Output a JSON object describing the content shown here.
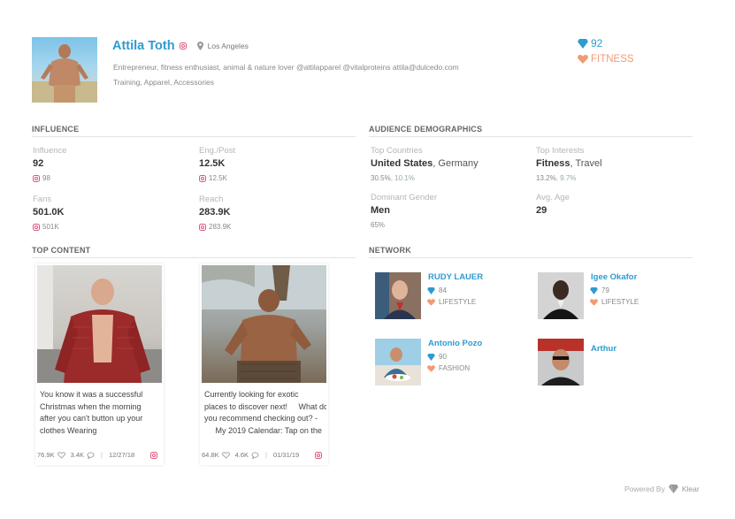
{
  "profile": {
    "name": "Attila Toth",
    "location": "Los Angeles",
    "bio_line1": "Entrepreneur, fitness enthusiast, animal & nature lover @attilapparel @vitalproteins attila@dulcedo.com",
    "bio_line2": "Training, Apparel, Accessories",
    "score": "92",
    "category": "FITNESS"
  },
  "influence": {
    "title": "INFLUENCE",
    "influence_label": "Influence",
    "influence_value": "92",
    "influence_sub": "98",
    "eng_label": "Eng./Post",
    "eng_value": "12.5K",
    "eng_sub": "12.5K",
    "fans_label": "Fans",
    "fans_value": "501.0K",
    "fans_sub": "501K",
    "reach_label": "Reach",
    "reach_value": "283.9K",
    "reach_sub": "283.9K"
  },
  "audience": {
    "title": "AUDIENCE DEMOGRAPHICS",
    "countries_label": "Top Countries",
    "country1": "United States",
    "country_sep": ", ",
    "country2": "Germany",
    "country_pct1": "30.5%",
    "country_pct_sep": ", ",
    "country_pct2": "10.1%",
    "interests_label": "Top Interests",
    "interest1": "Fitness",
    "interest_sep": ", ",
    "interest2": "Travel",
    "interest_pct1": "13.2%",
    "interest_pct_sep": ", ",
    "interest_pct2": "9.7%",
    "gender_label": "Dominant Gender",
    "gender_value": "Men",
    "gender_pct": "65%",
    "age_label": "Avg. Age",
    "age_value": "29"
  },
  "top_content": {
    "title": "TOP CONTENT",
    "posts": [
      {
        "caption": "You know it was a successful\nChristmas when the morning\nafter you can't button up your\nclothes    Wearing",
        "likes": "76.9K",
        "comments": "3.4K",
        "sep": "|",
        "date": "12/27/18"
      },
      {
        "caption": "Currently looking for exotic\nplaces to discover next!     What do\nyou recommend checking out? -\n     My 2019 Calendar: Tap on the",
        "likes": "64.8K",
        "comments": "4.6K",
        "sep": "|",
        "date": "01/31/19"
      }
    ]
  },
  "network": {
    "title": "NETWORK",
    "people": [
      {
        "name": "RUDY LAUER",
        "score": "84",
        "category": "LIFESTYLE"
      },
      {
        "name": "Igee Okafor",
        "score": "79",
        "category": "LIFESTYLE"
      },
      {
        "name": "Antonio Pozo",
        "score": "90",
        "category": "FASHION"
      },
      {
        "name": "Arthur",
        "score": "",
        "category": ""
      }
    ]
  },
  "footer": {
    "powered_by": "Powered By",
    "brand": "Klear"
  },
  "colors": {
    "accent_blue": "#2e9bd1",
    "accent_orange": "#f39a73",
    "instagram_pink": "#e0567a"
  }
}
